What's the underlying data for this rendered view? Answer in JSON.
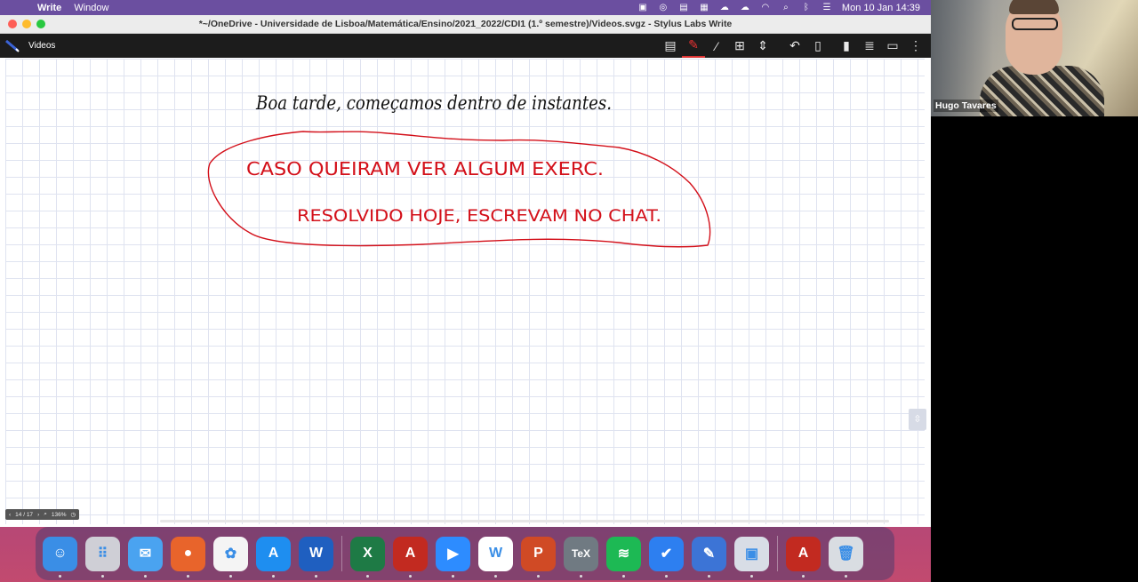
{
  "menubar": {
    "app_name": "Write",
    "menu_window": "Window",
    "clock": "Mon 10 Jan  14:39"
  },
  "window": {
    "title": "*~/OneDrive - Universidade de Lisboa/Matemática/Ensino/2021_2022/CDI1 (1.º semestre)/Videos.svgz - Stylus Labs Write",
    "doc_name": "Videos"
  },
  "canvas": {
    "line1": "Boa tarde, começamos dentro de instantes.",
    "line2": "CASO QUEIRAM VER ALGUM EXERC.",
    "line3": "RESOLVIDO HOJE, ESCREVAM NO CHAT.",
    "ink_black": "#111111",
    "ink_red": "#d3101a"
  },
  "status": {
    "page": "14 / 17",
    "zoom": "136%"
  },
  "dock": {
    "apps": [
      {
        "name": "Finder",
        "label": "☺",
        "color": "#3a8ee6"
      },
      {
        "name": "Launchpad",
        "label": "⠿",
        "color": "#cfcfd6"
      },
      {
        "name": "Mail",
        "label": "✉",
        "color": "#4aa3f0"
      },
      {
        "name": "Firefox",
        "label": "●",
        "color": "#e8642b"
      },
      {
        "name": "Photos",
        "label": "✿",
        "color": "#f4f4f4"
      },
      {
        "name": "App Store",
        "label": "A",
        "color": "#1e8ef0"
      },
      {
        "name": "Word",
        "label": "W",
        "color": "#1f5fc0"
      },
      {
        "name": "Excel",
        "label": "X",
        "color": "#1e7a45"
      },
      {
        "name": "Acrobat",
        "label": "A",
        "color": "#c22a20"
      },
      {
        "name": "Zoom",
        "label": "▶",
        "color": "#2d8cff"
      },
      {
        "name": "Write",
        "label": "W",
        "color": "#ffffff"
      },
      {
        "name": "PowerPoint",
        "label": "P",
        "color": "#d04a25"
      },
      {
        "name": "TeX",
        "label": "TeX",
        "color": "#707a82"
      },
      {
        "name": "Spotify",
        "label": "≋",
        "color": "#1db954"
      },
      {
        "name": "Tasks",
        "label": "✔",
        "color": "#2d7ff0"
      },
      {
        "name": "Pen",
        "label": "✎",
        "color": "#3c74d6"
      },
      {
        "name": "Preview",
        "label": "▣",
        "color": "#d8dde6"
      },
      {
        "name": "Acrobat Reader",
        "label": "A",
        "color": "#c22a20"
      },
      {
        "name": "Trash",
        "label": "🗑",
        "color": "#d9dde2"
      }
    ]
  },
  "participant": {
    "name": "Hugo Tavares"
  }
}
